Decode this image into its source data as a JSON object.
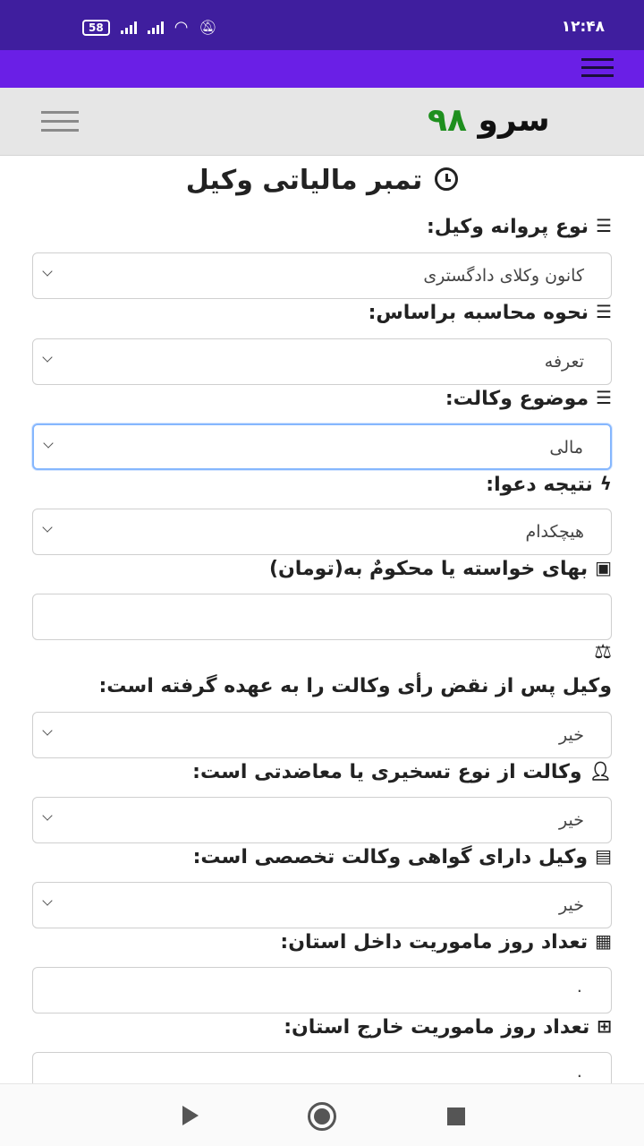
{
  "status_bar": {
    "time": "۱۲:۴۸",
    "battery": "58"
  },
  "header": {
    "brand_word": "سرو",
    "brand_number": "۹۸"
  },
  "page": {
    "title": "تمبر مالیاتی وکیل"
  },
  "form": {
    "license_type": {
      "label": "نوع پروانه وکیل:",
      "value": "کانون وکلای دادگستری"
    },
    "calc_method": {
      "label": "نحوه محاسبه براساس:",
      "value": "تعرفه"
    },
    "subject": {
      "label": "موضوع وکالت:",
      "value": "مالی"
    },
    "result": {
      "label": "نتیجه دعوا:",
      "value": "هیچکدام"
    },
    "claim_value": {
      "label": "بهای خواسته یا محکومٌ به(تومان)",
      "value": ""
    },
    "cassation": {
      "label": "وکیل پس از نقض رأی وکالت را به عهده گرفته است:",
      "value": "خیر"
    },
    "appointed": {
      "label": "وکالت از نوع تسخیری یا معاضدتی است:",
      "value": "خیر"
    },
    "specialist": {
      "label": "وکیل دارای گواهی وکالت تخصصی است:",
      "value": "خیر"
    },
    "days_inside": {
      "label": "تعداد روز ماموریت داخل استان:",
      "value": "۰"
    },
    "days_outside": {
      "label": "تعداد روز ماموریت خارج استان:",
      "value": "۰"
    }
  },
  "icons": {
    "list": "bars-icon",
    "bolt": "bolt-icon",
    "money": "money-icon",
    "scale": "balance-scale-icon",
    "user": "user-icon",
    "card": "id-card-icon",
    "calendar": "calendar-icon",
    "calendar_plus": "calendar-plus-icon"
  },
  "colors": {
    "status_bar": "#3f1e9e",
    "top_bar": "#6a1fe6",
    "brand_number": "#1e8f1e",
    "focus_border": "#86b7fe"
  }
}
